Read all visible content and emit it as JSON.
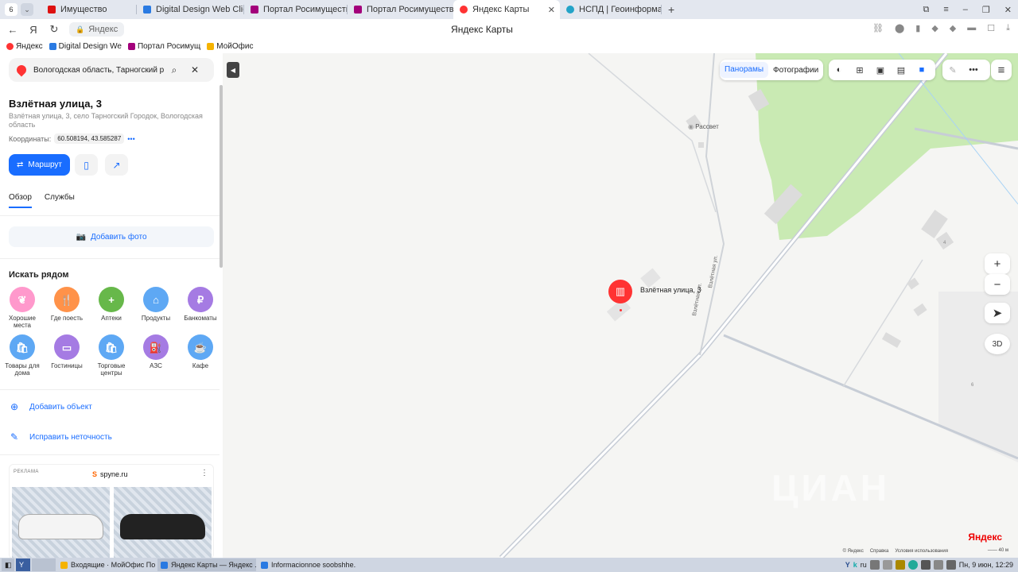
{
  "browser": {
    "tab_count": "6",
    "tabs": [
      {
        "label": "Имущество",
        "favicon": "rtc-icon",
        "fav_color": "#d11"
      },
      {
        "label": "Digital Design Web Client",
        "favicon": "dd-icon",
        "fav_color": "#2a7ae2"
      },
      {
        "label": "Портал Росимущества",
        "favicon": "rosim-icon",
        "fav_color": "#a3007b"
      },
      {
        "label": "Портал Росимущества",
        "favicon": "rosim-icon",
        "fav_color": "#a3007b"
      },
      {
        "label": "Яндекс Карты",
        "favicon": "yandex-maps-icon",
        "fav_color": "#f33"
      },
      {
        "label": "НСПД | Геоинформацион",
        "favicon": "nspd-icon",
        "fav_color": "#23a3c8"
      }
    ],
    "url_text": "Яндекс",
    "page_title": "Яндекс Карты",
    "bookmarks": [
      {
        "label": "Яндекс",
        "color": "#f33"
      },
      {
        "label": "Digital Design We",
        "color": "#2a7ae2"
      },
      {
        "label": "Портал Росимущ",
        "color": "#a3007b"
      },
      {
        "label": "МойОфис",
        "color": "#f5b300"
      }
    ]
  },
  "sidebar": {
    "search_value": "Вологодская область, Тарногский ра",
    "place_title": "Взлётная улица, 3",
    "place_address": "Взлётная улица, 3, село Тарногский Городок, Вологодская область",
    "coords_label": "Координаты:",
    "coords_value": "60.508194, 43.585287",
    "route_label": "Маршрут",
    "tab_overview": "Обзор",
    "tab_services": "Службы",
    "add_photo": "Добавить фото",
    "nearby_title": "Искать рядом",
    "categories": [
      {
        "label": "Хорошие места",
        "icon": "laurel-icon",
        "color": "#f9c"
      },
      {
        "label": "Где поесть",
        "icon": "fork-knife-icon",
        "color": "#ff9249"
      },
      {
        "label": "Аптеки",
        "icon": "plus-icon",
        "color": "#67b84a"
      },
      {
        "label": "Продукты",
        "icon": "basket-icon",
        "color": "#5ea8f4"
      },
      {
        "label": "Банкоматы",
        "icon": "ruble-icon",
        "color": "#a57be3"
      },
      {
        "label": "Товары для дома",
        "icon": "bag-icon",
        "color": "#5ea8f4"
      },
      {
        "label": "Гостиницы",
        "icon": "bed-icon",
        "color": "#a57be3"
      },
      {
        "label": "Торговые центры",
        "icon": "bag-icon",
        "color": "#5ea8f4"
      },
      {
        "label": "АЗС",
        "icon": "fuel-icon",
        "color": "#a57be3"
      },
      {
        "label": "Кафе",
        "icon": "cup-icon",
        "color": "#5ea8f4"
      }
    ],
    "add_object": "Добавить объект",
    "fix_error": "Исправить неточность",
    "ad_label": "РЕКЛАМА",
    "ad_brand": "spyne.ru"
  },
  "map": {
    "panoramas": "Панорамы",
    "photos": "Фотографии",
    "pin_label": "Взлётная улица, 3",
    "poi_label": "Рассвет",
    "street_label": "Взлётная ул.",
    "house_4": "4",
    "house_6": "6",
    "btn_3d": "3D",
    "logo": "Яндекс",
    "copyright": "© Яндекс",
    "help": "Справка",
    "terms": "Условия использования",
    "scale": "40 м",
    "watermark": "ЦИАН"
  },
  "taskbar": {
    "items": [
      {
        "label": "Входящие · МойОфис По...",
        "color": "#f5b300"
      },
      {
        "label": "Яндекс Карты — Яндекс ...",
        "color": "#2a7ae2"
      },
      {
        "label": "Informacionnoe soobshhe...",
        "color": "#2a7ae2"
      }
    ],
    "lang": "ru",
    "clock": "Пн, 9 июн, 12:29"
  }
}
